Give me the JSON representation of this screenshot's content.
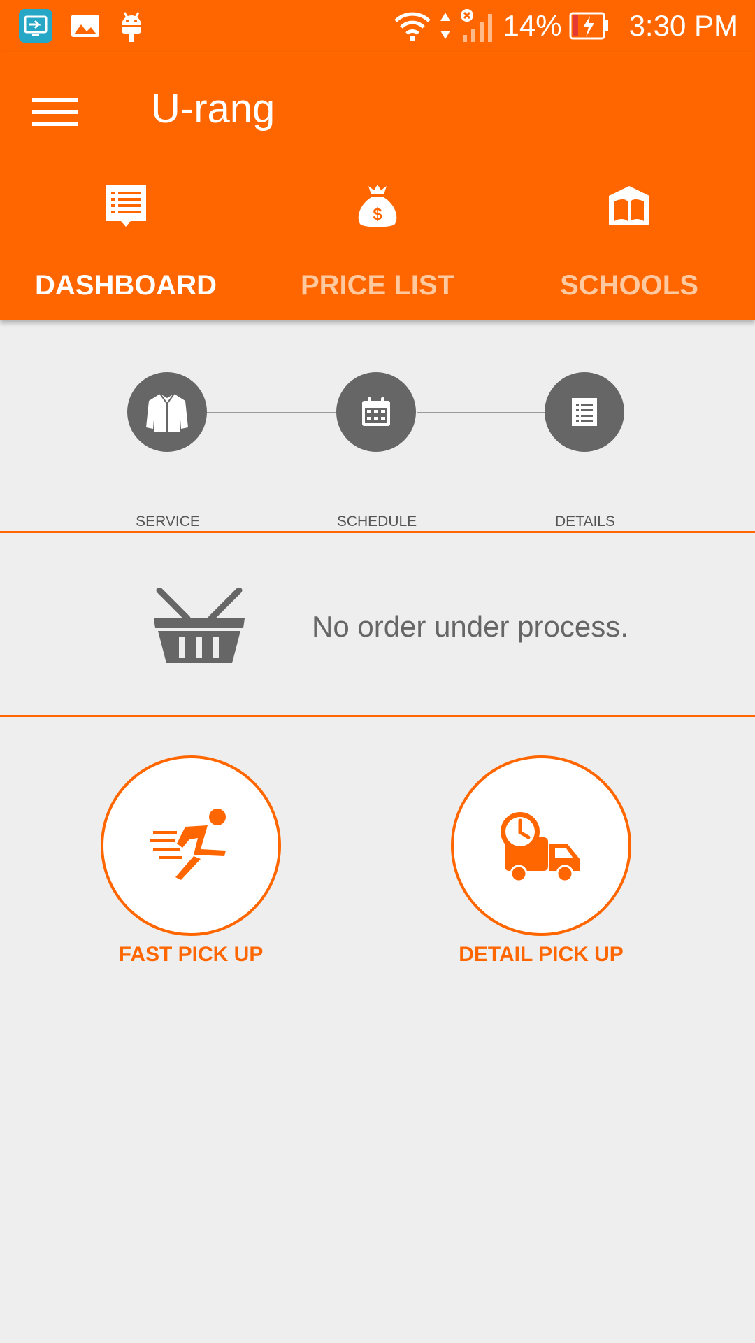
{
  "status_bar": {
    "battery": "14%",
    "time": "3:30 PM"
  },
  "app_bar": {
    "title": "U-rang"
  },
  "tabs": [
    {
      "label": "DASHBOARD",
      "icon": "dashboard-icon",
      "active": true
    },
    {
      "label": "PRICE LIST",
      "icon": "money-bag-icon",
      "active": false
    },
    {
      "label": "SCHOOLS",
      "icon": "book-icon",
      "active": false
    }
  ],
  "steps": [
    {
      "label": "SERVICE",
      "icon": "shirt-icon"
    },
    {
      "label": "SCHEDULE",
      "icon": "calendar-icon"
    },
    {
      "label": "DETAILS",
      "icon": "document-icon"
    }
  ],
  "order_status": {
    "message": "No order under process.",
    "icon": "basket-icon"
  },
  "pickup_options": [
    {
      "label": "FAST PICK UP",
      "icon": "running-person-icon"
    },
    {
      "label": "DETAIL PICK UP",
      "icon": "delivery-truck-icon"
    }
  ],
  "colors": {
    "accent": "#ff6600",
    "step_circle": "#666666",
    "background": "#eeeeee"
  }
}
